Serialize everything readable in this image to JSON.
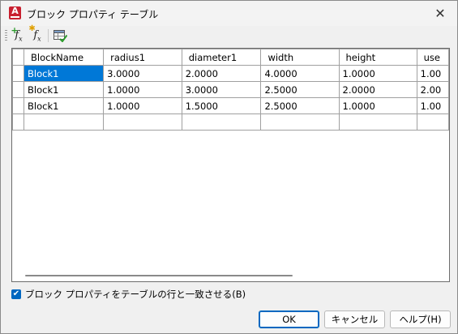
{
  "window": {
    "title": "ブロック プロパティ テーブル",
    "close_glyph": "✕"
  },
  "toolbar": {
    "icons": [
      "add-parameter-icon",
      "new-user-parameter-icon",
      "audit-table-icon"
    ]
  },
  "grid": {
    "columns": [
      "BlockName",
      "radius1",
      "diameter1",
      "width",
      "height",
      "use"
    ],
    "rows": [
      [
        "Block1",
        "3.0000",
        "2.0000",
        "4.0000",
        "1.0000",
        "1.00"
      ],
      [
        "Block1",
        "1.0000",
        "3.0000",
        "2.5000",
        "2.0000",
        "2.00"
      ],
      [
        "Block1",
        "1.0000",
        "1.5000",
        "2.5000",
        "1.0000",
        "1.00"
      ],
      [
        "",
        "",
        "",
        "",
        "",
        ""
      ]
    ],
    "selected_cell": "Block1"
  },
  "checkbox": {
    "label": "ブロック プロパティをテーブルの行と一致させる(B)",
    "checked": true
  },
  "buttons": {
    "ok": "OK",
    "cancel": "キャンセル",
    "help": "ヘルプ(H)"
  },
  "colors": {
    "selection": "#0078d7",
    "app_icon": "#c8202f",
    "accent": "#0067c0"
  }
}
